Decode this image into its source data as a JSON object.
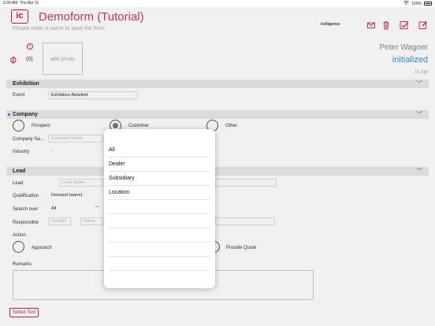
{
  "status_bar": {
    "time": "9:34 AM",
    "date": "Thu Apr 11",
    "battery": "100%"
  },
  "header": {
    "logo": "ic",
    "title": "Demoform (Tutorial)",
    "hint": "Please enter a name to save the form.",
    "brand_prefix": "it",
    "brand_suffix": "elligence"
  },
  "attachments": {
    "count": "(0)",
    "add_photo": "add photo"
  },
  "record": {
    "user": "Peter Wagner",
    "status": "initialized",
    "date": "11 Apr"
  },
  "exhibition": {
    "title": "Exhibition",
    "event_label": "Event",
    "event_value": "Exhibition Bielefeld"
  },
  "company": {
    "title": "Company",
    "radio_prospect": "Prospect",
    "radio_customer": "Customer",
    "radio_other": "Other",
    "name_label": "Company Na...",
    "name_placeholder": "Company Name",
    "industry_label": "Industry",
    "industry_value": "-"
  },
  "lead": {
    "title": "Lead",
    "lead_label": "Lead",
    "lead_placeholder": "Lead Name",
    "qualification_label": "Qualification",
    "qualification_value": "Demand (warm)",
    "search_label": "Search over",
    "search_value": "All",
    "responsible_label": "Responsible",
    "emplid_placeholder": "EmplID",
    "name_placeholder": "Name",
    "action_label": "Action",
    "radio_approach": "Approach",
    "radio_quote": "Provide Quote",
    "remarks_label": "Remarks",
    "select_text_button": "Select Text"
  },
  "popover": {
    "options": [
      "All",
      "Dealer",
      "Subsidiary",
      "Location",
      "",
      "",
      "",
      "",
      "",
      ""
    ]
  },
  "colors": {
    "accent": "#c8204b",
    "status": "#3c8ce0",
    "section": "#e9e9ec"
  }
}
